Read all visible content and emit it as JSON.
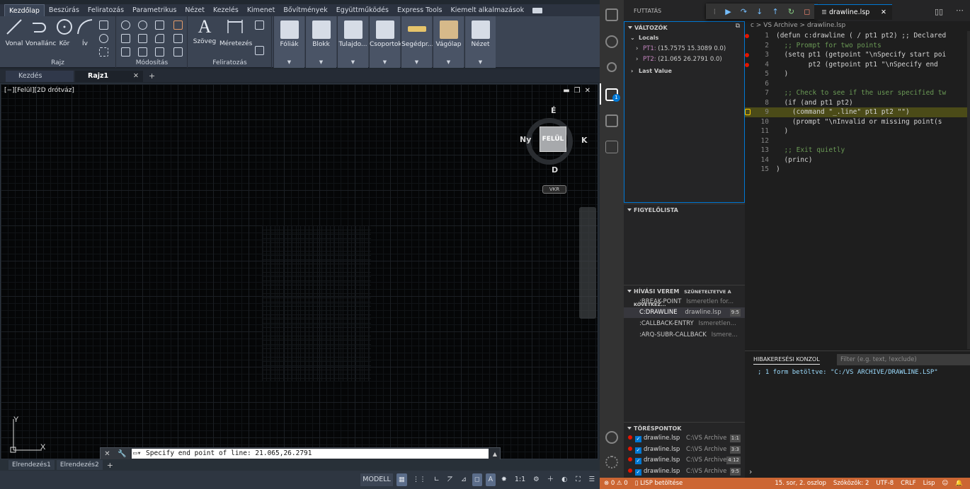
{
  "autocad": {
    "ribbon_tabs": [
      "Kezdőlap",
      "Beszúrás",
      "Feliratozás",
      "Parametrikus",
      "Nézet",
      "Kezelés",
      "Kimenet",
      "Bővítmények",
      "Együttműködés",
      "Express Tools",
      "Kiemelt alkalmazások"
    ],
    "draw_tools": [
      "Vonal",
      "Vonallánc",
      "Kör",
      "Ív"
    ],
    "panel_titles": {
      "rajz": "Rajz",
      "modositas": "Módosítás",
      "feliratozas": "Feliratozás"
    },
    "annot_tools": [
      "Szöveg",
      "Méretezés"
    ],
    "big_buttons": [
      "Fóliák",
      "Blokk",
      "Tulajdo...",
      "Csoportok",
      "Segédpr...",
      "Vágólap",
      "Nézet"
    ],
    "doc_tabs": [
      "Kezdés",
      "Rajz1"
    ],
    "viewport_label": "[−][Felül][2D drótváz]",
    "viewcube": {
      "face": "FELÜL",
      "north": "É",
      "south": "D",
      "east": "K",
      "west": "Ny",
      "ucs": "VKR"
    },
    "ucs": {
      "x": "X",
      "y": "Y"
    },
    "command_text": "Specify end point of line: 21.065,26.2791",
    "layout_tabs": [
      "Elrendezés1",
      "Elrendezés2"
    ],
    "status": {
      "model": "MODELL",
      "scale": "1:1"
    }
  },
  "vscode": {
    "sidebar_title": "FUTTATÁS",
    "variables_title": "VÁLTOZÓK",
    "locals_label": "Locals",
    "vars": [
      {
        "name": "PT1:",
        "value": "(15.7575 15.3089 0.0)"
      },
      {
        "name": "PT2:",
        "value": "(21.065 26.2791 0.0)"
      }
    ],
    "last_value": "Last Value",
    "watch_title": "FIGYELŐLISTA",
    "callstack_title": "HÍVÁSI VEREM",
    "callstack_status": "SZÜNETELTETVE A KÖVETKEZ...",
    "callstack": [
      {
        "name": ":BREAK-POINT",
        "file": "Ismeretlen for...",
        "pos": ""
      },
      {
        "name": "C:DRAWLINE",
        "file": "drawline.lsp",
        "pos": "9:5"
      },
      {
        "name": ":CALLBACK-ENTRY",
        "file": "Ismeretlen...",
        "pos": ""
      },
      {
        "name": ":ARQ-SUBR-CALLBACK",
        "file": "Ismere...",
        "pos": ""
      }
    ],
    "breakpoints_title": "TÖRÉSPONTOK",
    "breakpoints": [
      {
        "file": "drawline.lsp",
        "dir": "C:\\VS Archive",
        "pos": "1:1"
      },
      {
        "file": "drawline.lsp",
        "dir": "C:\\VS Archive",
        "pos": "3:3"
      },
      {
        "file": "drawline.lsp",
        "dir": "C:\\VS Archive",
        "pos": "4:12"
      },
      {
        "file": "drawline.lsp",
        "dir": "C:\\VS Archive",
        "pos": "9:5"
      }
    ],
    "tab_label": "drawline.lsp",
    "breadcrumb": "c > VS Archive > drawline.lsp",
    "code": [
      "(defun c:drawline ( / pt1 pt2) ;; Declared",
      "  ;; Prompt for two points",
      "  (setq pt1 (getpoint \"\\nSpecify start poi",
      "        pt2 (getpoint pt1 \"\\nSpecify end",
      "  )",
      "",
      "  ;; Check to see if the user specified tw",
      "  (if (and pt1 pt2)",
      "    (command \"_.line\" pt1 pt2 \"\")",
      "    (prompt \"\\nInvalid or missing point(s",
      "  )",
      "",
      "  ;; Exit quietly",
      "  (princ)",
      ")"
    ],
    "console_tab": "HIBAKERESÉSI KONZOL",
    "filter_placeholder": "Filter (e.g. text, !exclude)",
    "console_output": "; 1 form betöltve: \"C:/VS ARCHIVE/DRAWLINE.LSP\"",
    "statusbar": {
      "problems": "⊗ 0  ⚠ 0",
      "lisp": "LISP betöltése",
      "position": "15. sor, 2. oszlop",
      "spaces": "Szóközök: 2",
      "encoding": "UTF-8",
      "eol": "CRLF",
      "lang": "Lisp"
    }
  }
}
